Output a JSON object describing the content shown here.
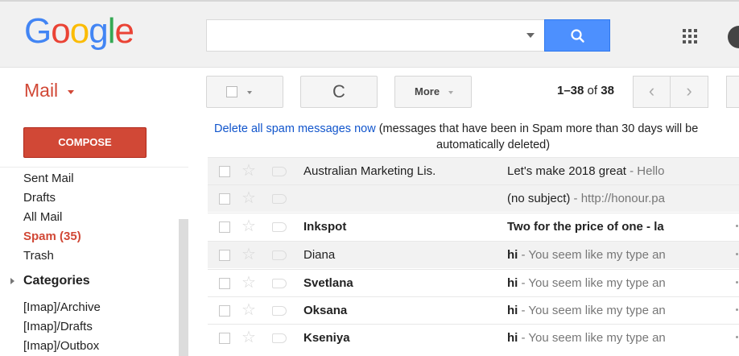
{
  "header": {
    "logo_letters": [
      {
        "ch": "G",
        "color": "#4285f4"
      },
      {
        "ch": "o",
        "color": "#ea4335"
      },
      {
        "ch": "o",
        "color": "#fbbc05"
      },
      {
        "ch": "g",
        "color": "#4285f4"
      },
      {
        "ch": "l",
        "color": "#34a853"
      },
      {
        "ch": "e",
        "color": "#ea4335"
      }
    ],
    "search_value": "",
    "search_icon": "magnifier-icon",
    "apps_icon": "apps-grid-icon"
  },
  "app": {
    "label": "Mail"
  },
  "toolbar": {
    "refresh_glyph": "C",
    "more_label": "More",
    "pager_range": "1–38",
    "pager_of": "of",
    "pager_total": "38",
    "prev_glyph": "‹",
    "next_glyph": "›"
  },
  "sidebar": {
    "compose_label": "COMPOSE",
    "items": [
      {
        "label": "Sent Mail"
      },
      {
        "label": "Drafts"
      },
      {
        "label": "All Mail"
      },
      {
        "label": "Spam (35)"
      },
      {
        "label": "Trash"
      },
      {
        "label": "Categories"
      },
      {
        "label": "[Imap]/Archive"
      },
      {
        "label": "[Imap]/Drafts"
      },
      {
        "label": "[Imap]/Outbox"
      }
    ]
  },
  "spam_notice": {
    "link": "Delete all spam messages now",
    "text_line1": " (messages that have been in Spam more than 30 days will be",
    "text_line2": "automatically deleted)"
  },
  "messages": [
    {
      "sender": "Australian Marketing Lis.",
      "subject": "Let's make 2018 great",
      "snippet": " - Hello"
    },
    {
      "sender": "",
      "subject": "(no subject)",
      "snippet": " - http://honour.pa"
    },
    {
      "sender": "Inkspot",
      "subject": "Two for the price of one - la",
      "snippet": ""
    },
    {
      "sender": "Diana",
      "subject": "hi",
      "snippet": " - You seem like my type an"
    },
    {
      "sender": "Svetlana",
      "subject": "hi",
      "snippet": " - You seem like my type an"
    },
    {
      "sender": "Oksana",
      "subject": "hi",
      "snippet": " - You seem like my type an"
    },
    {
      "sender": "Kseniya",
      "subject": "hi",
      "snippet": " - You seem like my type an"
    }
  ],
  "colors": {
    "accent_red": "#d14836",
    "search_blue": "#4d90fe",
    "link_blue": "#1155cc"
  }
}
